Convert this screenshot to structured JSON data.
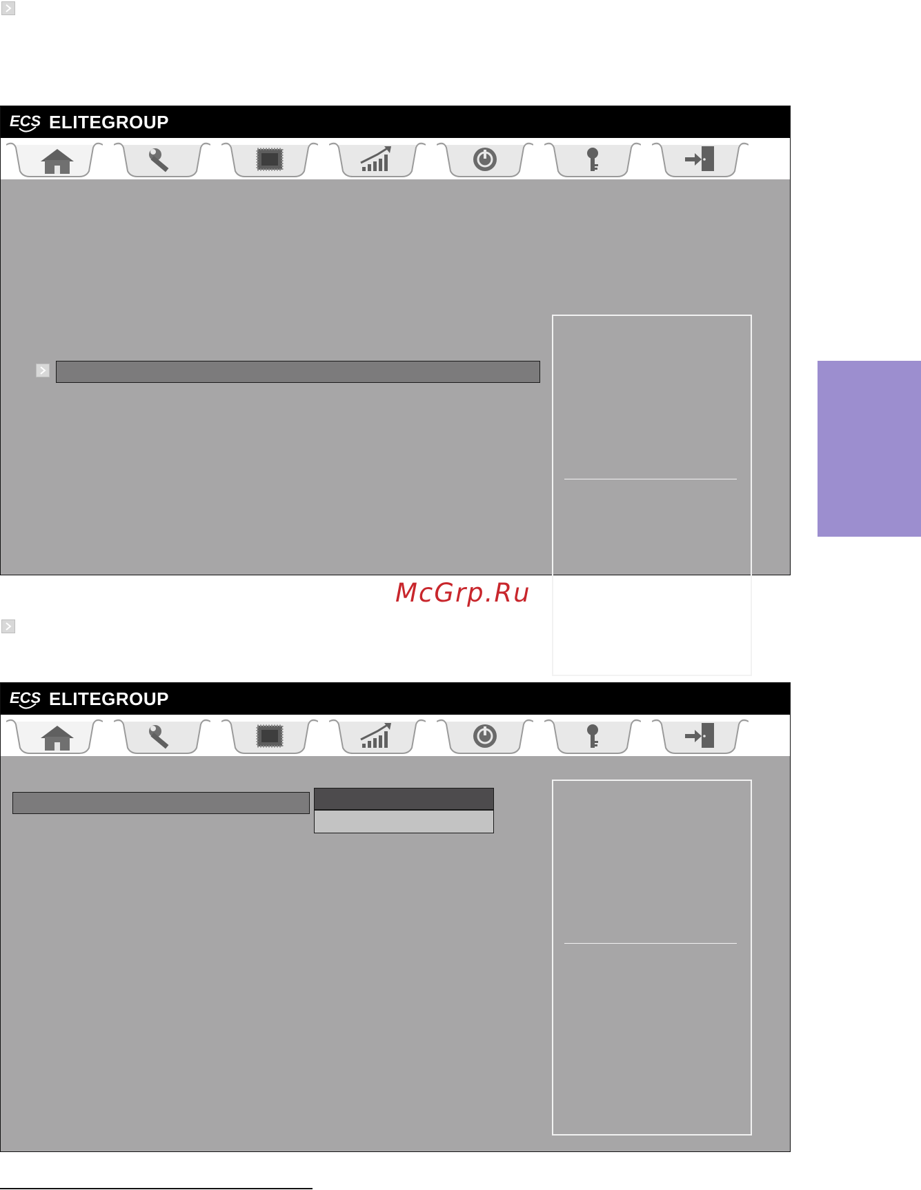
{
  "page": {
    "accent_color": "#9c8ecf",
    "watermark_color": "#c8262c",
    "watermark": "McGrp.Ru"
  },
  "screens": [
    {
      "brand": "ELITEGROUP",
      "logo_text": "ECS",
      "tabs": [
        {
          "icon": "home-icon",
          "selected": true
        },
        {
          "icon": "wrench-icon",
          "selected": false
        },
        {
          "icon": "chip-icon",
          "selected": false
        },
        {
          "icon": "chart-icon",
          "selected": false
        },
        {
          "icon": "power-icon",
          "selected": false
        },
        {
          "icon": "key-icon",
          "selected": false
        },
        {
          "icon": "exit-icon",
          "selected": false
        }
      ],
      "highlighted_item": "",
      "help_text": ""
    },
    {
      "brand": "ELITEGROUP",
      "logo_text": "ECS",
      "tabs": [
        {
          "icon": "home-icon",
          "selected": true
        },
        {
          "icon": "wrench-icon",
          "selected": false
        },
        {
          "icon": "chip-icon",
          "selected": false
        },
        {
          "icon": "chart-icon",
          "selected": false
        },
        {
          "icon": "power-icon",
          "selected": false
        },
        {
          "icon": "key-icon",
          "selected": false
        },
        {
          "icon": "exit-icon",
          "selected": false
        }
      ],
      "highlighted_item": "",
      "popup_options": [
        "",
        ""
      ],
      "help_text": ""
    }
  ]
}
